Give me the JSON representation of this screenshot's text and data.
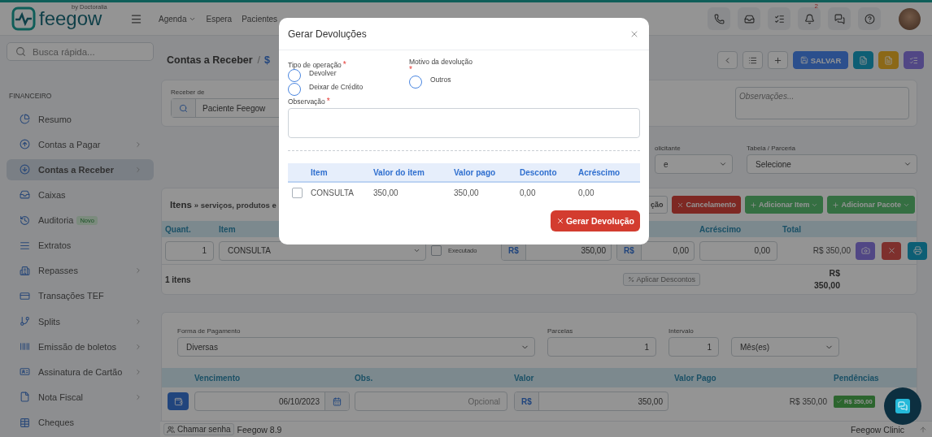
{
  "topbar": {
    "logo": "feegow",
    "logo_tag": "by Doctoralia",
    "nav": [
      {
        "label": "Agenda",
        "dropdown": true
      },
      {
        "label": "Espera",
        "dropdown": false
      },
      {
        "label": "Pacientes",
        "dropdown": false
      }
    ],
    "notification_count": "2"
  },
  "sidebar": {
    "search_placeholder": "Busca rápida...",
    "section": "FINANCEIRO",
    "items": [
      {
        "label": "Resumo",
        "selected": false,
        "submenu": false
      },
      {
        "label": "Contas a Pagar",
        "selected": false,
        "submenu": true
      },
      {
        "label": "Contas a Receber",
        "selected": true,
        "submenu": true
      },
      {
        "label": "Caixas",
        "selected": false,
        "submenu": false
      },
      {
        "label": "Auditoria",
        "selected": false,
        "submenu": false,
        "badge": "Novo"
      },
      {
        "label": "Extratos",
        "selected": false,
        "submenu": false
      },
      {
        "label": "Repasses",
        "selected": false,
        "submenu": true
      },
      {
        "label": "Transações TEF",
        "selected": false,
        "submenu": false
      },
      {
        "label": "Splits",
        "selected": false,
        "submenu": true
      },
      {
        "label": "Emissão de boletos",
        "selected": false,
        "submenu": true
      },
      {
        "label": "Assinatura de Cartão",
        "selected": false,
        "submenu": true
      },
      {
        "label": "Nota Fiscal",
        "selected": false,
        "submenu": true
      },
      {
        "label": "Cheques",
        "selected": false,
        "submenu": false
      }
    ]
  },
  "page": {
    "title": "Contas a Receber",
    "separator": "/",
    "currency_symbol": "$",
    "save_label": "SALVAR"
  },
  "receive": {
    "label": "Receber de",
    "value": "Paciente Feegow",
    "notes_placeholder": "Observações..."
  },
  "filters": [
    {
      "label": "olicitante",
      "value": "e"
    },
    {
      "label": "Tabela / Parceria",
      "value": "Selecione"
    }
  ],
  "items": {
    "title": "Itens",
    "subtitle": "» serviços, produtos e",
    "actions": [
      {
        "label": "ção",
        "kind": "outline",
        "dropdown": false
      },
      {
        "label": "Cancelamento",
        "kind": "danger",
        "dropdown": false
      },
      {
        "label": "Adicionar Item",
        "kind": "success",
        "dropdown": true
      },
      {
        "label": "Adicionar Pacote",
        "kind": "success",
        "dropdown": true
      }
    ],
    "columns": [
      "Quant.",
      "Item",
      "Acréscimo",
      "Total"
    ],
    "row": {
      "qty": "1",
      "item": "CONSULTA",
      "executed": false,
      "executed_label": "Executado",
      "discount_currency": "R$",
      "discount": "350,00",
      "increase_currency": "R$",
      "increase": "0,00",
      "extra": "0,00",
      "total": "R$ 350,00"
    },
    "count": "1 itens",
    "apply_discounts": "Aplicar Descontos",
    "grand_total": "R$ 350,00"
  },
  "payment": {
    "method_label": "Forma de Pagamento",
    "method": "Diversas",
    "installments_label": "Parcelas",
    "installments": "1",
    "interval_label": "Intervalo",
    "interval": "1",
    "unit": "Mês(es)",
    "columns": [
      "Vencimento",
      "Obs.",
      "Valor",
      "Valor Pago",
      "Pendências"
    ],
    "row": {
      "due": "06/10/2023",
      "obs_placeholder": "Opcional",
      "currency": "R$",
      "value": "350,00",
      "paid": "R$ 350,00",
      "pending": "R$ 350,00"
    }
  },
  "footer": {
    "call": "Chamar senha",
    "version": "Feegow 8.9",
    "product": "Feegow Clinic"
  },
  "modal": {
    "title": "Gerar Devoluções",
    "operation_label": "Tipo de operação",
    "operation_options": [
      {
        "label": "Devolver",
        "selected": false
      },
      {
        "label": "Deixar de Crédito",
        "selected": false
      }
    ],
    "reason_label": "Motivo da devolução",
    "reason_options": [
      {
        "label": "Outros",
        "selected": false
      }
    ],
    "note_label": "Observação",
    "required_mark": "*",
    "columns": [
      "Item",
      "Valor do item",
      "Valor pago",
      "Desconto",
      "Acréscimo"
    ],
    "rows": [
      {
        "checked": false,
        "cells": [
          "CONSULTA",
          "350,00",
          "350,00",
          "0,00",
          "0,00"
        ]
      }
    ],
    "submit": "Gerar Devolução"
  }
}
